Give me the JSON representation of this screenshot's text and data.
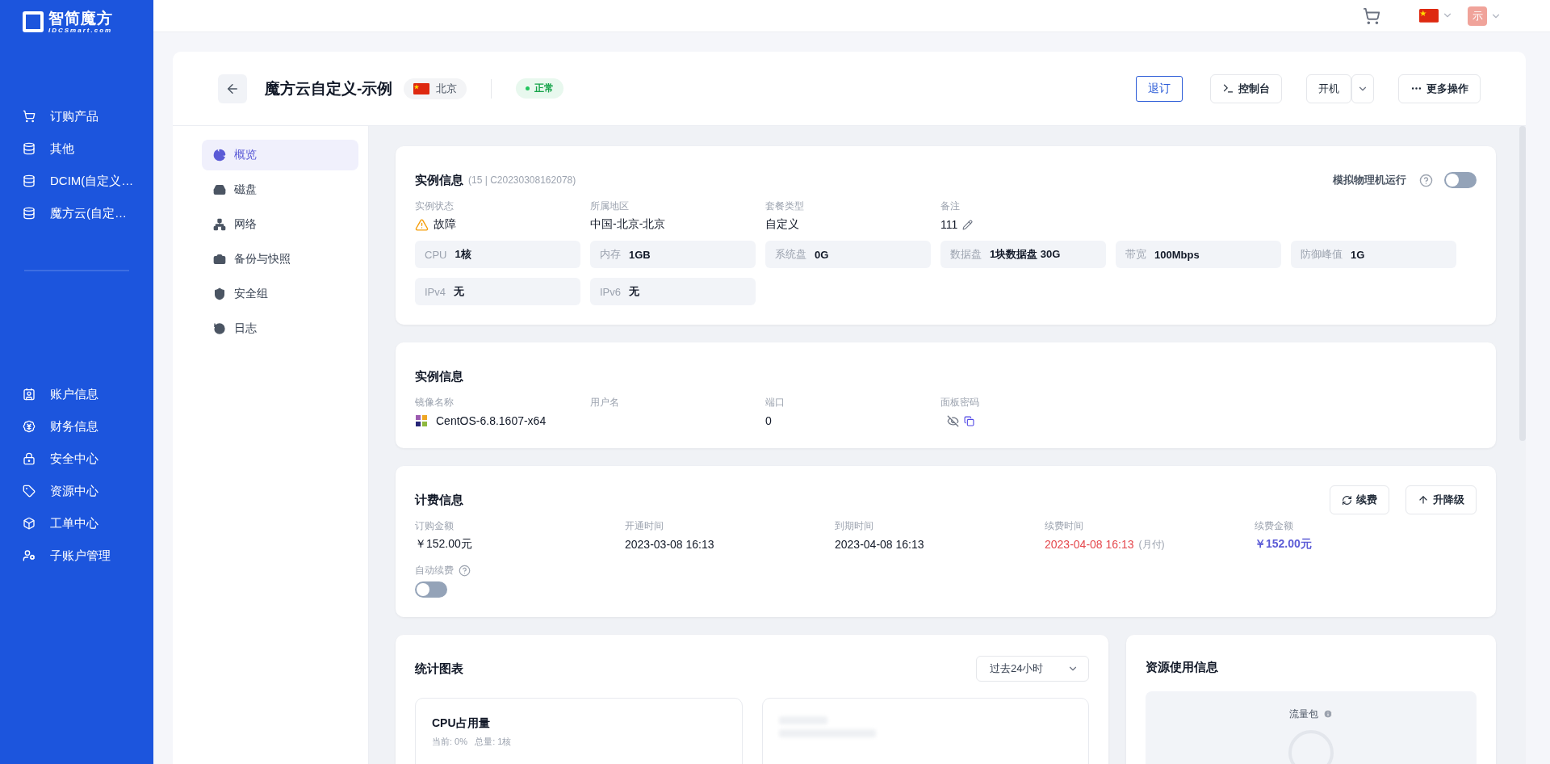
{
  "brand": {
    "name": "智简魔方",
    "sub": "IDCSmart.com"
  },
  "sidebar": {
    "top_items": [
      {
        "label": "订购产品"
      },
      {
        "label": "其他"
      },
      {
        "label": "DCIM(自定义…"
      },
      {
        "label": "魔方云(自定…"
      }
    ],
    "bottom_items": [
      {
        "label": "账户信息"
      },
      {
        "label": "财务信息"
      },
      {
        "label": "安全中心"
      },
      {
        "label": "资源中心"
      },
      {
        "label": "工单中心"
      },
      {
        "label": "子账户管理"
      }
    ]
  },
  "topbar": {
    "avatar": "示"
  },
  "header": {
    "title": "魔方云自定义-示例",
    "region": "北京",
    "status": "正常"
  },
  "actions": {
    "unsubscribe": "退订",
    "console": "控制台",
    "power": "开机",
    "more": "更多操作"
  },
  "tabs": [
    {
      "label": "概览",
      "selected": true
    },
    {
      "label": "磁盘",
      "selected": false
    },
    {
      "label": "网络",
      "selected": false
    },
    {
      "label": "备份与快照",
      "selected": false
    },
    {
      "label": "安全组",
      "selected": false
    },
    {
      "label": "日志",
      "selected": false
    }
  ],
  "instance_card": {
    "title": "实例信息",
    "meta": "(15 | C20230308162078)",
    "simulate": {
      "label": "模拟物理机运行",
      "on": false
    },
    "fields": [
      {
        "label": "实例状态",
        "value": "故障",
        "kind": "warning"
      },
      {
        "label": "所属地区",
        "value": "中国-北京-北京",
        "kind": "text"
      },
      {
        "label": "套餐类型",
        "value": "自定义",
        "kind": "text"
      },
      {
        "label": "备注",
        "value": "111",
        "kind": "editable"
      }
    ],
    "specs": [
      {
        "label": "CPU",
        "value": "1核"
      },
      {
        "label": "内存",
        "value": "1GB"
      },
      {
        "label": "系统盘",
        "value": "0G"
      },
      {
        "label": "数据盘",
        "value": "1块数据盘 30G"
      },
      {
        "label": "带宽",
        "value": "100Mbps"
      },
      {
        "label": "防御峰值",
        "value": "1G"
      },
      {
        "label": "IPv4",
        "value": "无"
      },
      {
        "label": "IPv6",
        "value": "无"
      }
    ]
  },
  "system_card": {
    "title": "实例信息",
    "fields": [
      {
        "label": "镜像名称",
        "value": "CentOS-6.8.1607-x64",
        "kind": "os"
      },
      {
        "label": "用户名",
        "kind": "text"
      },
      {
        "label": "端口",
        "value": "0",
        "kind": "text"
      },
      {
        "label": "面板密码",
        "kind": "password"
      }
    ]
  },
  "billing_card": {
    "title": "计费信息",
    "buttons": [
      "续费",
      "升降级"
    ],
    "fields": [
      {
        "label": "订购金额",
        "value": "￥152.00元",
        "kind": "text"
      },
      {
        "label": "开通时间",
        "value": "2023-03-08 16:13",
        "kind": "text"
      },
      {
        "label": "到期时间",
        "value": "2023-04-08 16:13",
        "kind": "text"
      },
      {
        "label": "续费时间",
        "value": "2023-04-08 16:13",
        "note": "(月付)",
        "kind": "due"
      },
      {
        "label": "续费金额",
        "value": "￥152.00元",
        "kind": "price"
      }
    ],
    "auto_renew": {
      "label": "自动续费",
      "on": false
    }
  },
  "stats_card": {
    "title": "统计图表",
    "range": "过去24小时",
    "charts": [
      {
        "title": "CPU占用量",
        "subtitle": "当前: 0%   总量: 1核"
      }
    ]
  },
  "resources_card": {
    "title": "资源使用信息",
    "package": "流量包"
  }
}
